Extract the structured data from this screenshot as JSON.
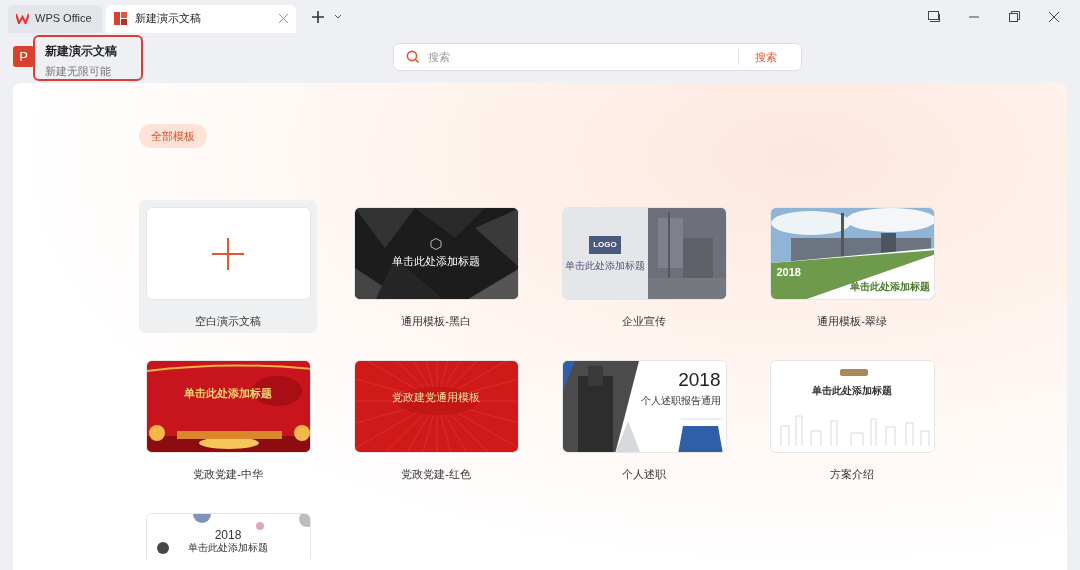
{
  "tabs": [
    {
      "label": "WPS Office",
      "kind": "home",
      "selected": false
    },
    {
      "label": "新建演示文稿",
      "kind": "doc",
      "selected": true
    }
  ],
  "header": {
    "icon_letter": "P",
    "title": "新建演示文稿",
    "subtitle": "新建无限可能"
  },
  "search": {
    "placeholder": "搜索",
    "button": "搜索"
  },
  "filter": {
    "label": "全部模板",
    "selected": true
  },
  "templates": [
    {
      "label": "空白演示文稿",
      "kind": "blank",
      "selected": true
    },
    {
      "label": "通用模板-黑白",
      "kind": "dark",
      "selected": false,
      "title": "单击此处添加标题"
    },
    {
      "label": "企业宣传",
      "kind": "logo",
      "selected": false,
      "badge": "LOGO",
      "title": "单击此处添加标题"
    },
    {
      "label": "通用模板-翠绿",
      "kind": "green",
      "selected": false,
      "year": "2018",
      "title": "单击此处添加标题"
    },
    {
      "label": "党政党建-中华",
      "kind": "redgold",
      "selected": false,
      "title": "单击此处添加标题"
    },
    {
      "label": "党政党建-红色",
      "kind": "redray",
      "selected": false,
      "title": "党政建党通用模板"
    },
    {
      "label": "个人述职",
      "kind": "report",
      "selected": false,
      "year": "2018",
      "title": "个人述职报告通用"
    },
    {
      "label": "方案介绍",
      "kind": "city",
      "selected": false,
      "title": "单击此处添加标题"
    },
    {
      "kind": "dots",
      "selected": false,
      "year": "2018",
      "title": "单击此处添加标题"
    }
  ]
}
